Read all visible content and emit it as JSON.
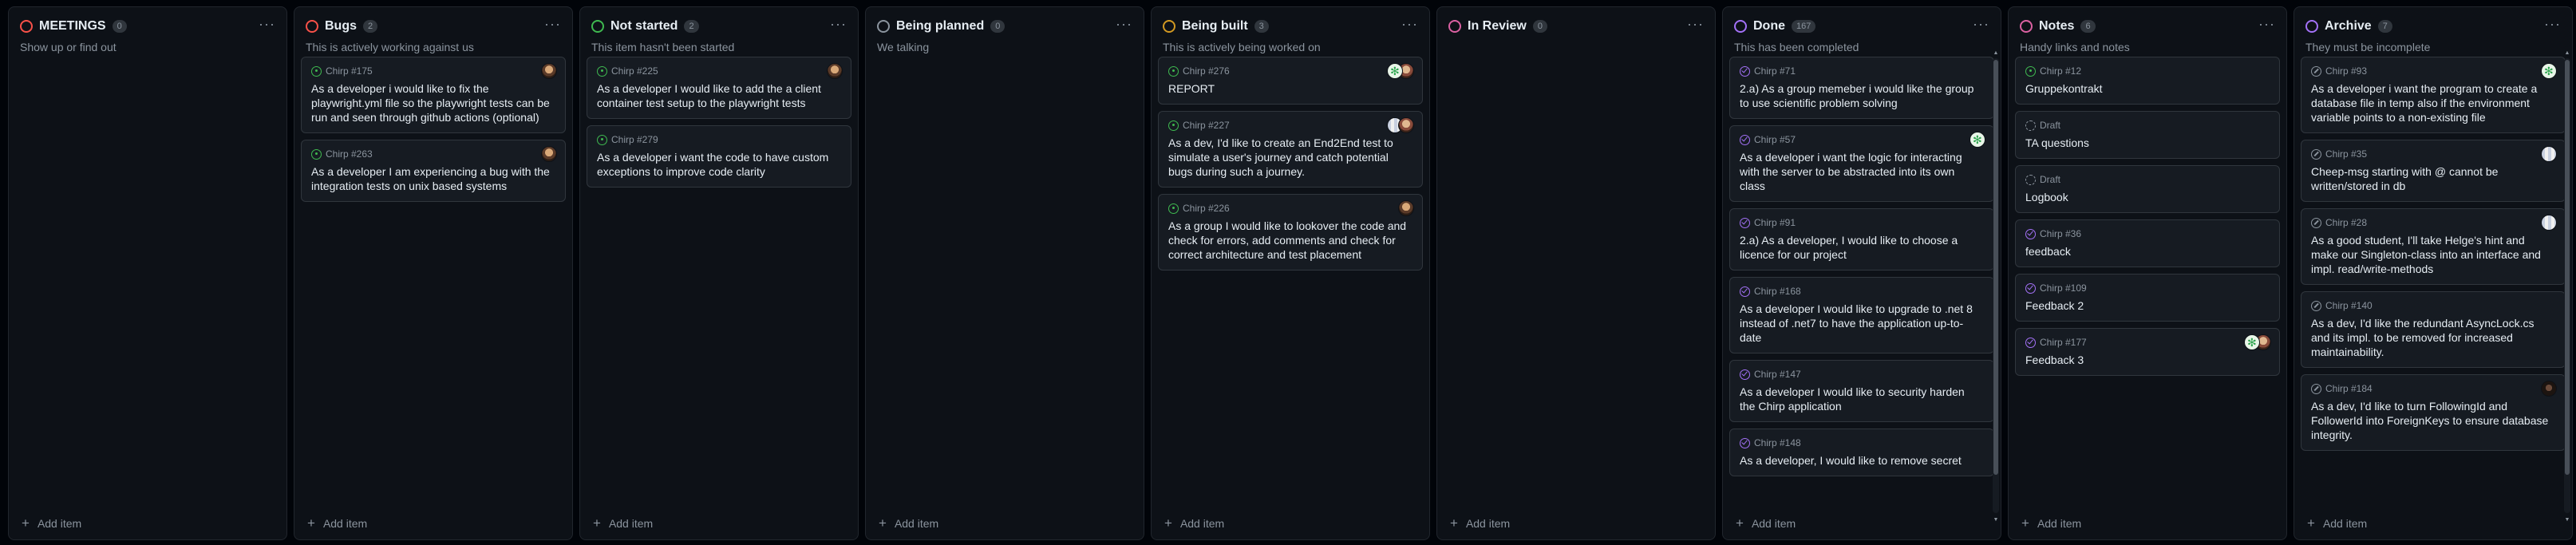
{
  "board": {
    "add_item_label": "Add item",
    "columns": [
      {
        "title": "MEETINGS",
        "count": "0",
        "color": "#f85149",
        "description": "Show up or find out",
        "cards": []
      },
      {
        "title": "Bugs",
        "count": "2",
        "color": "#f85149",
        "description": "This is actively working against us",
        "cards": [
          {
            "repo": "Chirp #175",
            "title": "As a developer i would like to fix the playwright.yml file so the playwright tests can be run and seen through github actions (optional)",
            "state": "open",
            "avatars": [
              "photo"
            ]
          },
          {
            "repo": "Chirp #263",
            "title": "As a developer I am experiencing a bug with the integration tests on unix based systems",
            "state": "open",
            "avatars": [
              "photo"
            ]
          }
        ]
      },
      {
        "title": "Not started",
        "count": "2",
        "color": "#3fb950",
        "description": "This item hasn't been started",
        "cards": [
          {
            "repo": "Chirp #225",
            "title": "As a developer I would like to add the a client container test setup to the playwright tests",
            "state": "open",
            "avatars": [
              "photo"
            ]
          },
          {
            "repo": "Chirp #279",
            "title": "As a developer i want the code to have custom exceptions to improve code clarity",
            "state": "open",
            "avatars": []
          }
        ]
      },
      {
        "title": "Being planned",
        "count": "0",
        "color": "#8b949e",
        "description": "We talking",
        "cards": []
      },
      {
        "title": "Being built",
        "count": "3",
        "color": "#d29922",
        "description": "This is actively being worked on",
        "cards": [
          {
            "repo": "Chirp #276",
            "title": "REPORT",
            "state": "open",
            "avatars": [
              "green",
              "photo2"
            ]
          },
          {
            "repo": "Chirp #227",
            "title": "As a dev, I'd like to create an End2End test to simulate a user's journey and catch potential bugs during such a journey.",
            "state": "open",
            "avatars": [
              "pixel",
              "photo2"
            ]
          },
          {
            "repo": "Chirp #226",
            "title": "As a group I would like to lookover the code and check for errors, add comments and check for correct architecture and test placement",
            "state": "open",
            "avatars": [
              "photo"
            ]
          }
        ]
      },
      {
        "title": "In Review",
        "count": "0",
        "color": "#db61a2",
        "description": "",
        "cards": []
      },
      {
        "title": "Done",
        "count": "167",
        "color": "#a371f7",
        "description": "This has been completed",
        "scroll": true,
        "cards": [
          {
            "repo": "Chirp #71",
            "title": "2.a) As a group memeber i would like the group to use scientific problem solving",
            "state": "closed",
            "avatars": []
          },
          {
            "repo": "Chirp #57",
            "title": "As a developer i want the logic for interacting with the server to be abstracted into its own class",
            "state": "closed",
            "avatars": [
              "green"
            ]
          },
          {
            "repo": "Chirp #91",
            "title": "2.a) As a developer, I would like to choose a licence for our project",
            "state": "closed",
            "avatars": []
          },
          {
            "repo": "Chirp #168",
            "title": "As a developer I would like to upgrade to .net 8 instead of .net7 to have the application up-to-date",
            "state": "closed",
            "avatars": []
          },
          {
            "repo": "Chirp #147",
            "title": "As a developer I would like to security harden the Chirp application",
            "state": "closed",
            "avatars": []
          },
          {
            "repo": "Chirp #148",
            "title": "As a developer, I would like to remove secret",
            "state": "closed",
            "avatars": [],
            "clipped": true
          }
        ]
      },
      {
        "title": "Notes",
        "count": "6",
        "color": "#db61a2",
        "description": "Handy links and notes",
        "cards": [
          {
            "repo": "Chirp #12",
            "title": "Gruppekontrakt",
            "state": "open",
            "avatars": []
          },
          {
            "repo": "Draft",
            "title": "TA questions",
            "state": "draft",
            "avatars": []
          },
          {
            "repo": "Draft",
            "title": "Logbook",
            "state": "draft",
            "avatars": []
          },
          {
            "repo": "Chirp #36",
            "title": "feedback",
            "state": "closed",
            "avatars": []
          },
          {
            "repo": "Chirp #109",
            "title": "Feedback 2",
            "state": "closed",
            "avatars": []
          },
          {
            "repo": "Chirp #177",
            "title": "Feedback 3",
            "state": "closed",
            "avatars": [
              "green",
              "photo2"
            ]
          }
        ]
      },
      {
        "title": "Archive",
        "count": "7",
        "color": "#a371f7",
        "description": "They must be incomplete",
        "scroll": true,
        "cards": [
          {
            "repo": "Chirp #93",
            "title": "As a developer i want the program to create a database file in temp also if the environment variable points to a non-existing file",
            "state": "unplanned",
            "avatars": [
              "green"
            ]
          },
          {
            "repo": "Chirp #35",
            "title": "Cheep-msg starting with @ cannot be written/stored in db",
            "state": "unplanned",
            "avatars": [
              "pixel"
            ]
          },
          {
            "repo": "Chirp #28",
            "title": "As a good student, I'll take Helge's hint and make our Singleton-class into an interface and impl. read/write-methods",
            "state": "unplanned",
            "avatars": [
              "pixel"
            ]
          },
          {
            "repo": "Chirp #140",
            "title": "As a dev, I'd like the redundant AsyncLock.cs and its impl. to be removed for increased maintainability.",
            "state": "unplanned",
            "avatars": []
          },
          {
            "repo": "Chirp #184",
            "title": "As a dev, I'd like to turn FollowingId and FollowerId into ForeignKeys to ensure database integrity.",
            "state": "unplanned",
            "avatars": [
              "dark"
            ]
          }
        ]
      }
    ]
  }
}
